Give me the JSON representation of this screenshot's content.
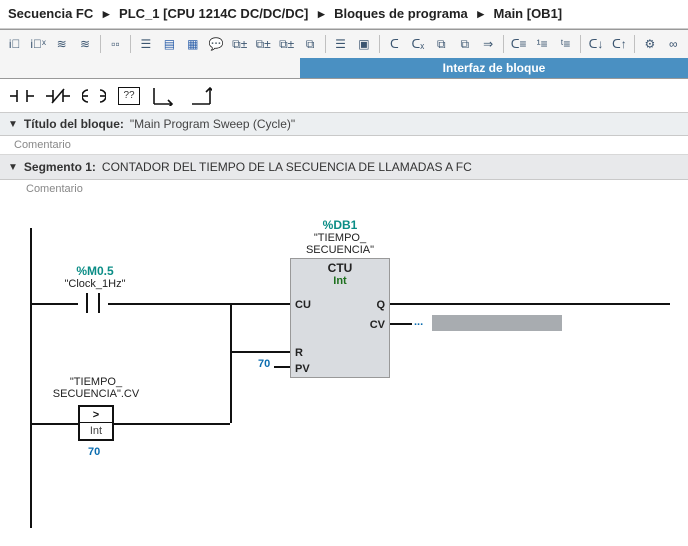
{
  "breadcrumb": {
    "p1": "Secuencia FC",
    "p2": "PLC_1 [CPU 1214C DC/DC/DC]",
    "p3": "Bloques de programa",
    "p4": "Main [OB1]",
    "sep": "▸"
  },
  "interface_bar": "Interfaz de bloque",
  "palette_question": "??",
  "block_title": {
    "label": "Título del bloque:",
    "value": "\"Main Program Sweep (Cycle)\"",
    "comment_placeholder": "Comentario"
  },
  "segment": {
    "label": "Segmento 1:",
    "title": "CONTADOR DEL TIEMPO DE LA SECUENCIA DE LLAMADAS A FC",
    "comment_placeholder": "Comentario"
  },
  "ladder": {
    "db_sym": "%DB1",
    "db_name_l1": "\"TIEMPO_",
    "db_name_l2": "SECUENCIA\"",
    "ctu_type": "CTU",
    "ctu_int": "Int",
    "pin_cu": "CU",
    "pin_r": "R",
    "pin_pv": "PV",
    "pin_q": "Q",
    "pin_cv": "CV",
    "in1_sym": "%M0.5",
    "in1_name": "\"Clock_1Hz\"",
    "in2_name_l1": "\"TIEMPO_",
    "in2_name_l2": "SECUENCIA\".CV",
    "cmp_op": ">",
    "cmp_type": "Int",
    "cmp_const": "70",
    "pv_const": "70",
    "cv_out": "..."
  }
}
